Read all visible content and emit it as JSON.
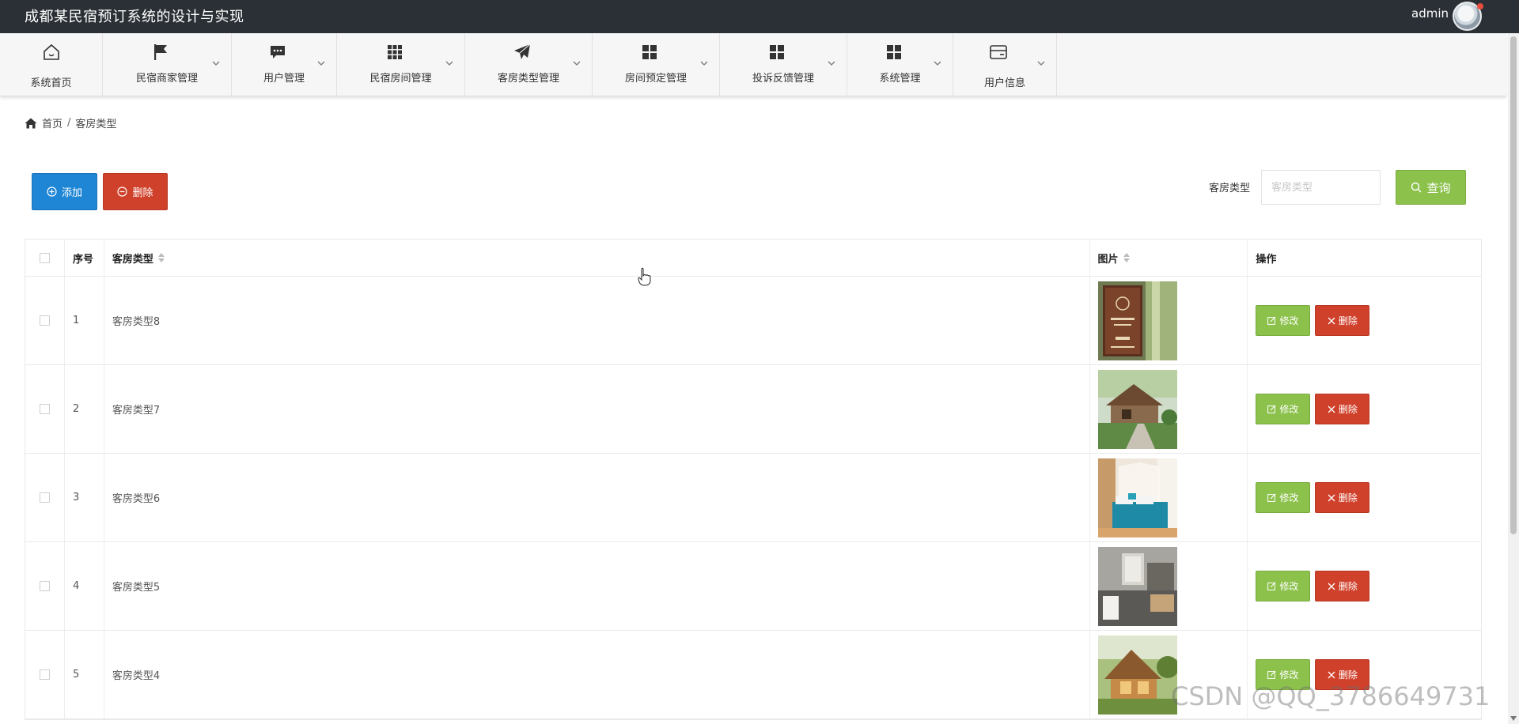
{
  "app": {
    "title": "成都某民宿预订系统的设计与实现",
    "user": "admin"
  },
  "nav": [
    {
      "label": "系统首页",
      "icon": "home-icon"
    },
    {
      "label": "民宿商家管理",
      "icon": "flag-icon"
    },
    {
      "label": "用户管理",
      "icon": "chat-icon"
    },
    {
      "label": "民宿房间管理",
      "icon": "grid-dots-icon"
    },
    {
      "label": "客房类型管理",
      "icon": "paper-plane-icon"
    },
    {
      "label": "房间预定管理",
      "icon": "grid-squares-icon"
    },
    {
      "label": "投诉反馈管理",
      "icon": "grid-squares-icon"
    },
    {
      "label": "系统管理",
      "icon": "grid-squares-icon"
    },
    {
      "label": "用户信息",
      "icon": "card-icon"
    }
  ],
  "breadcrumb": {
    "home": "首页",
    "separator": "/",
    "current": "客房类型"
  },
  "toolbar": {
    "add_label": "添加",
    "delete_label": "删除"
  },
  "search": {
    "label": "客房类型",
    "placeholder": "客房类型",
    "button": "查询"
  },
  "table": {
    "headers": {
      "index": "序号",
      "type": "客房类型",
      "image": "图片",
      "action": "操作"
    },
    "rows": [
      {
        "index": "1",
        "type": "客房类型8",
        "image": "sign-board-photo"
      },
      {
        "index": "2",
        "type": "客房类型7",
        "image": "cabin-garden-photo"
      },
      {
        "index": "3",
        "type": "客房类型6",
        "image": "bedroom-photo"
      },
      {
        "index": "4",
        "type": "客房类型5",
        "image": "bathroom-photo"
      },
      {
        "index": "5",
        "type": "客房类型4",
        "image": "wooden-cabin-photo"
      }
    ],
    "edit_label": "修改",
    "delete_label": "删除"
  },
  "watermark": "CSDN @QQ_3786649731",
  "colors": {
    "topbar": "#2a3035",
    "primary": "#1f86d6",
    "danger": "#d0412c",
    "success": "#8cc14c"
  }
}
